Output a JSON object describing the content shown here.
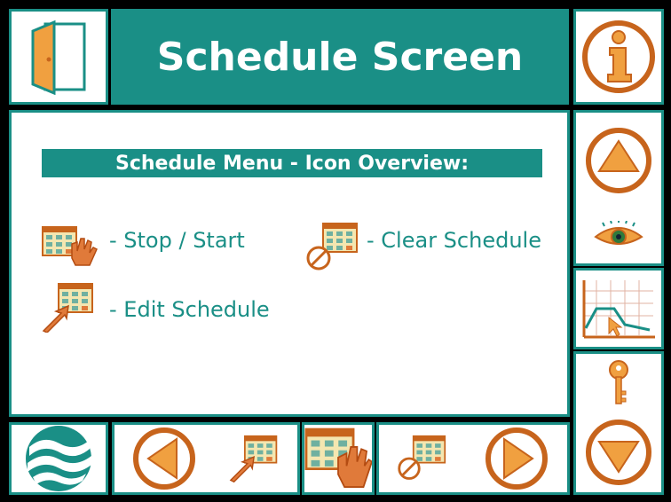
{
  "header": {
    "title": "Schedule Screen"
  },
  "content": {
    "menu_title": "Schedule Menu - Icon Overview:",
    "legend": {
      "stop_start": "- Stop / Start",
      "clear_schedule": "- Clear Schedule",
      "edit_schedule": "- Edit Schedule"
    }
  },
  "icons": {
    "exit": "door-icon",
    "info": "info-icon",
    "up": "arrow-up-icon",
    "view": "eye-icon",
    "graph": "graph-icon",
    "key": "key-icon",
    "down": "arrow-down-icon",
    "logo": "wave-logo-icon",
    "prev": "arrow-left-icon",
    "next": "arrow-right-icon",
    "stop_start": "schedule-hand-icon",
    "edit": "schedule-edit-icon",
    "clear": "schedule-clear-icon"
  },
  "colors": {
    "teal": "#1a8f86",
    "orange": "#f0a040",
    "dark_orange": "#c7641c",
    "black": "#000000"
  }
}
